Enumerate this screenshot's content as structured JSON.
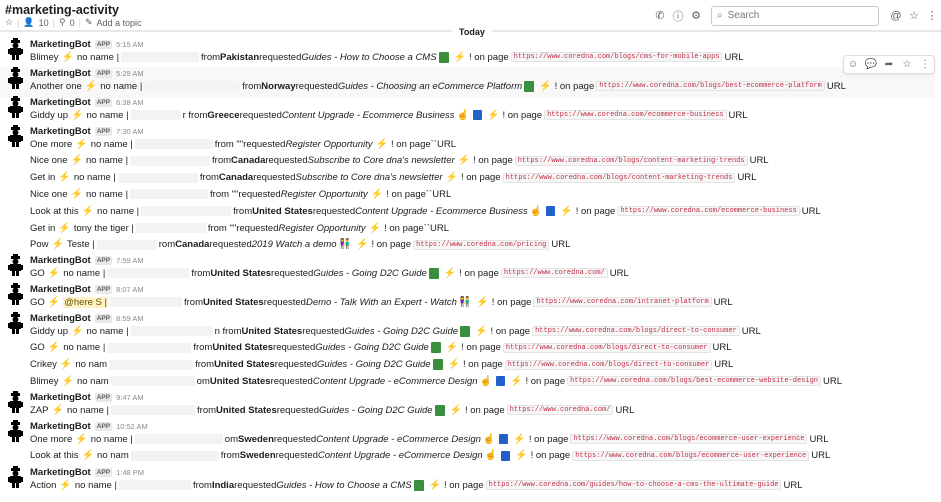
{
  "header": {
    "channel_name": "#marketing-activity",
    "members": "10",
    "pins": "0",
    "add_topic": "Add a topic",
    "search_placeholder": "Search",
    "date_divider": "Today"
  },
  "bot": {
    "name": "MarketingBot",
    "badge": "APP"
  },
  "messages": [
    {
      "ts": "5:15 AM",
      "lines": [
        [
          "Blimey",
          "no name |",
          "from",
          "Pakistan",
          "requested",
          "Guides - How to Choose a CMS",
          "! on page",
          "https://www.coredna.com/blogs/cms-for-mobile-apps",
          "URL"
        ]
      ]
    },
    {
      "ts": "5:29 AM",
      "lines": [
        [
          "Another one",
          "no name |",
          "from",
          "Norway",
          "requested",
          "Guides - Choosing an eCommerce Platform",
          "! on page",
          "https://www.coredna.com/blogs/best-ecommerce-platform",
          "URL"
        ]
      ]
    },
    {
      "ts": "6:38 AM",
      "lines": [
        [
          "Giddy up",
          "no name |",
          "r from",
          "Greece",
          "requested",
          "Content Upgrade - Ecommerce Business",
          "! on page",
          "https://www.coredna.com/ecommerce-business",
          "URL"
        ]
      ]
    },
    {
      "ts": "7:30 AM",
      "lines": [
        [
          "One more",
          "no name |",
          "from \"\"",
          "",
          "requested",
          "Register Opportunity",
          "! on page",
          "``",
          "URL"
        ],
        [
          "Nice one",
          "no name |",
          "from",
          "Canada",
          "requested",
          "Subscribe to Core dna's newsletter",
          "! on page",
          "https://www.coredna.com/blogs/content-marketing-trends",
          "URL"
        ],
        [
          "Get in",
          "no name |",
          "from",
          "Canada",
          "requested",
          "Subscribe to Core dna's newsletter",
          "! on page",
          "https://www.coredna.com/blogs/content-marketing-trends",
          "URL"
        ],
        [
          "Nice one",
          "no name |",
          "from \"\"",
          "",
          "requested",
          "Register Opportunity",
          "! on page",
          "``",
          "URL"
        ],
        [
          "Look at this",
          "no name |",
          "from",
          "United States",
          "requested",
          "Content Upgrade - Ecommerce Business",
          "! on page",
          "https://www.coredna.com/ecommerce-business",
          "URL"
        ],
        [
          "Get in",
          "tony the tiger |",
          "from \"\"",
          "",
          "requested",
          "Register Opportunity",
          "! on page",
          "``",
          "URL"
        ],
        [
          "Pow",
          "Teste |",
          "rom",
          "Canada",
          "requested",
          "2019 Watch a demo",
          "! on page",
          "https://www.coredna.com/pricing",
          "URL"
        ]
      ]
    },
    {
      "ts": "7:59 AM",
      "lines": [
        [
          "GO",
          "no name |",
          "from",
          "United States",
          "requested",
          "Guides - Going D2C Guide",
          "! on page",
          "https://www.coredna.com/",
          "URL"
        ]
      ]
    },
    {
      "ts": "8:07 AM",
      "lines": [
        [
          "GO",
          "@here S |",
          "from",
          "United States",
          "requested",
          "Demo - Talk With an Expert - Watch",
          "! on page",
          "https://www.coredna.com/intranet-platform",
          "URL"
        ]
      ]
    },
    {
      "ts": "8:59 AM",
      "lines": [
        [
          "Giddy up",
          "no name |",
          "n from",
          "United States",
          "requested",
          "Guides - Going D2C Guide",
          "! on page",
          "https://www.coredna.com/blogs/direct-to-consumer",
          "URL"
        ],
        [
          "GO",
          "no name |",
          "from",
          "United States",
          "requested",
          "Guides - Going D2C Guide",
          "! on page",
          "https://www.coredna.com/blogs/direct-to-consumer",
          "URL"
        ],
        [
          "Crikey",
          "no nam",
          "from",
          "United States",
          "requested",
          "Guides - Going D2C Guide",
          "! on page",
          "https://www.coredna.com/blogs/direct-to-consumer",
          "URL"
        ],
        [
          "Blimey",
          "no nam",
          "om",
          "United States",
          "requested",
          "Content Upgrade - eCommerce Design",
          "! on page",
          "https://www.coredna.com/blogs/best-ecommerce-website-design",
          "URL"
        ]
      ]
    },
    {
      "ts": "9:47 AM",
      "lines": [
        [
          "ZAP",
          "no name |",
          "from",
          "United States",
          "requested",
          "Guides - Going D2C Guide",
          "! on page",
          "https://www.coredna.com/",
          "URL"
        ]
      ]
    },
    {
      "ts": "10:52 AM",
      "lines": [
        [
          "One more",
          "no name |",
          "om",
          "Sweden",
          "requested",
          "Content Upgrade - eCommerce Design",
          "! on page",
          "https://www.coredna.com/blogs/ecommerce-user-experience",
          "URL"
        ],
        [
          "Look at this",
          "no nam",
          "from",
          "Sweden",
          "requested",
          "Content Upgrade - eCommerce Design",
          "! on page",
          "https://www.coredna.com/blogs/ecommerce-user-experience",
          "URL"
        ]
      ]
    },
    {
      "ts": "1:48 PM",
      "lines": [
        [
          "Action",
          "no name |",
          "from",
          "India",
          "requested",
          "Guides - How to Choose a CMS",
          "! on page",
          "https://www.coredna.com/guides/how-to-choose-a-cms-the-ultimate-guide",
          "URL"
        ]
      ]
    }
  ]
}
